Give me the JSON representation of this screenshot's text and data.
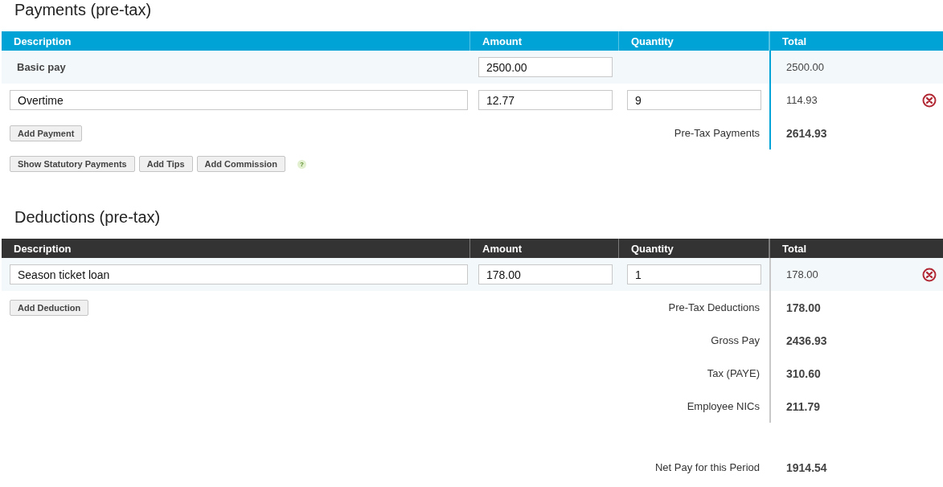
{
  "sections": [
    {
      "kind": "payments",
      "title": "Payments (pre-tax)",
      "columns": [
        "Description",
        "Amount",
        "Quantity",
        "Total"
      ],
      "rows": [
        {
          "kind": "fixed",
          "description": "Basic pay",
          "amount": "2500.00",
          "total": "2500.00"
        },
        {
          "kind": "editable",
          "description": "Overtime",
          "amount": "12.77",
          "quantity": "9",
          "total": "114.93"
        }
      ],
      "add_button": "Add Payment",
      "summary": [
        {
          "label": "Pre-Tax Payments",
          "value": "2614.93"
        }
      ],
      "extra_buttons": [
        "Show Statutory Payments",
        "Add Tips",
        "Add Commission"
      ],
      "help_mark": "?"
    },
    {
      "kind": "deductions",
      "title": "Deductions (pre-tax)",
      "columns": [
        "Description",
        "Amount",
        "Quantity",
        "Total"
      ],
      "rows": [
        {
          "kind": "editable",
          "description": "Season ticket loan",
          "amount": "178.00",
          "quantity": "1",
          "total": "178.00"
        }
      ],
      "add_button": "Add Deduction",
      "summary": [
        {
          "label": "Pre-Tax Deductions",
          "value": "178.00"
        },
        {
          "label": "Gross Pay",
          "value": "2436.93"
        },
        {
          "label": "Tax (PAYE)",
          "value": "310.60"
        },
        {
          "label": "Employee NICs",
          "value": "211.79"
        }
      ]
    }
  ],
  "net_pay": {
    "label": "Net Pay for this Period",
    "value": "1914.54"
  }
}
